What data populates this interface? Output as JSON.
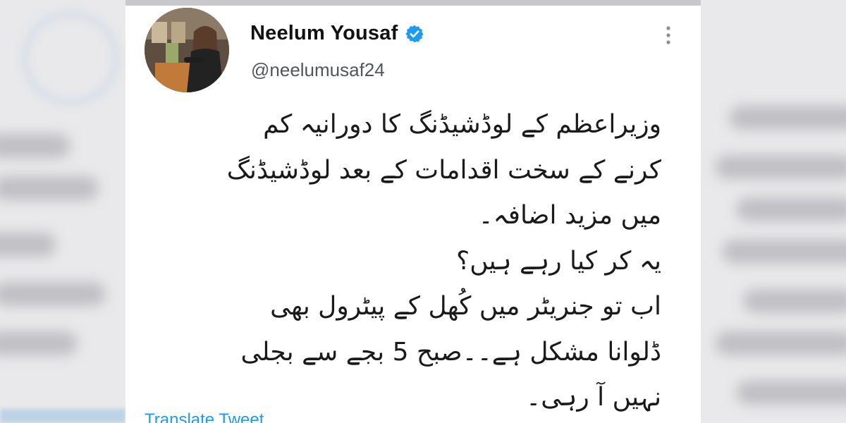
{
  "tweet": {
    "author": {
      "display_name": "Neelum Yousaf",
      "handle": "@neelumusaf24",
      "verified": true,
      "verified_color": "#1d9bf0",
      "avatar_icon": "profile-photo"
    },
    "more_icon": "more-vertical-icon",
    "body_lines": [
      "وزیراعظم کے لوڈشیڈنگ کا دورانیہ کم",
      "کرنے کے سخت اقدامات کے بعد لوڈشیڈنگ",
      "میں مزید اضافہ۔",
      "یہ کر کیا رہے ہیں؟",
      "اب تو جنریٹر میں کُھل کے پیٹرول بھی",
      "ڈلوانا مشکل ہے۔۔صبح 5 بجے سے بجلی",
      "نہیں آ رہی۔"
    ],
    "translate_label": "Translate Tweet",
    "link_color": "#1d9bf0"
  }
}
